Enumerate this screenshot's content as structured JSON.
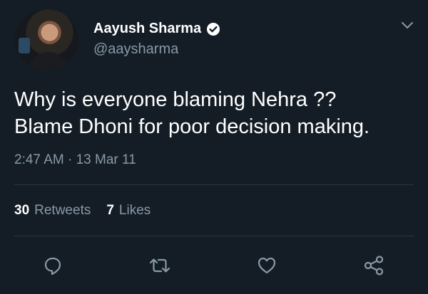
{
  "tweet": {
    "author_name": "Aayush Sharma",
    "author_handle": "@aaysharma",
    "text_lines": [
      "Why is everyone blaming Nehra ??",
      "Blame Dhoni for poor decision making."
    ],
    "time": "2:47 AM",
    "separator": "·",
    "date": "13 Mar 11",
    "retweets_count": "30",
    "retweets_label": "Retweets",
    "likes_count": "7",
    "likes_label": "Likes"
  },
  "icons": {
    "verified": "verified-badge-icon",
    "caret": "chevron-down-icon",
    "reply": "reply-icon",
    "retweet": "retweet-icon",
    "like": "heart-icon",
    "share": "share-icon"
  },
  "colors": {
    "background": "#141d26",
    "primary_text": "#ffffff",
    "secondary_text": "#8899a6",
    "divider": "#2b3640"
  }
}
